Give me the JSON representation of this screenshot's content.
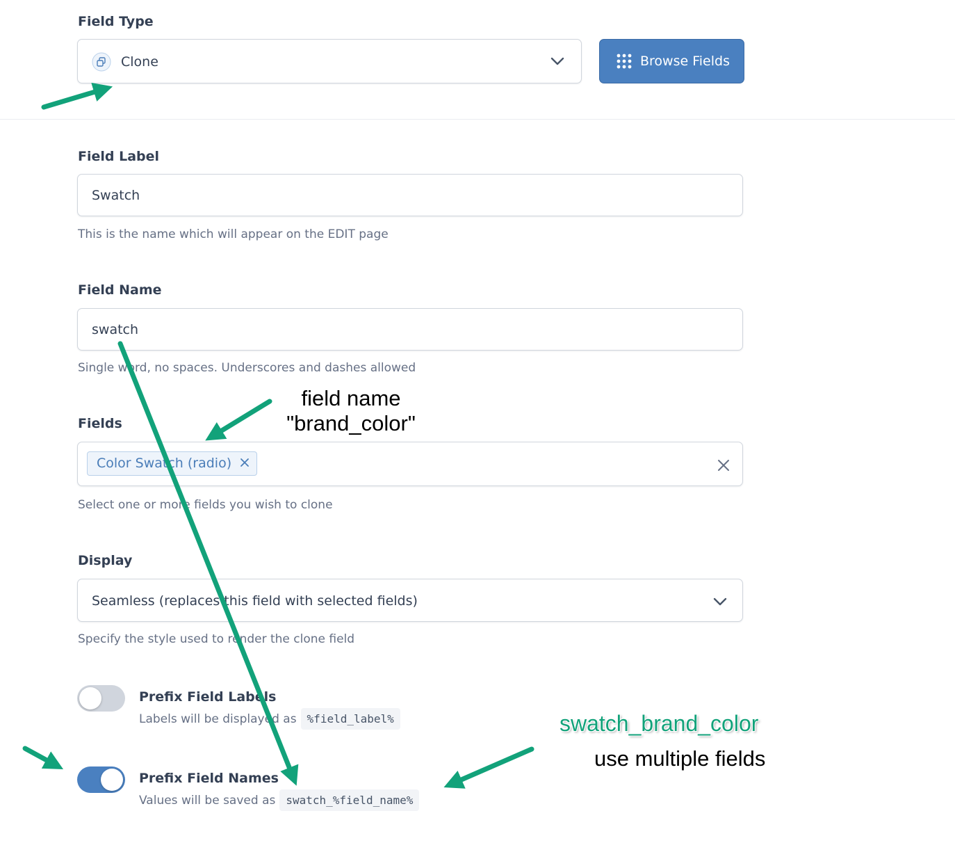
{
  "field_type": {
    "label": "Field Type",
    "value": "Clone",
    "button": "Browse Fields"
  },
  "field_label": {
    "label": "Field Label",
    "value": "Swatch",
    "help": "This is the name which will appear on the EDIT page"
  },
  "field_name": {
    "label": "Field Name",
    "value": "swatch",
    "help": "Single word, no spaces. Underscores and dashes allowed"
  },
  "fields": {
    "label": "Fields",
    "chip": "Color Swatch (radio)",
    "help": "Select one or more fields you wish to clone"
  },
  "display": {
    "label": "Display",
    "value": "Seamless (replaces this field with selected fields)",
    "help": "Specify the style used to render the clone field"
  },
  "prefix_labels": {
    "title": "Prefix Field Labels",
    "desc": "Labels will be displayed as",
    "code": "%field_label%",
    "on": false
  },
  "prefix_names": {
    "title": "Prefix Field Names",
    "desc": "Values will be saved as",
    "code": "swatch_%field_name%",
    "on": true
  },
  "annotations": {
    "field_name_line1": "field name",
    "field_name_line2": "\"brand_color\"",
    "result": "swatch_brand_color",
    "multiple": "use multiple fields"
  },
  "colors": {
    "accent": "#4a80c0",
    "arrow": "#12a27a"
  }
}
